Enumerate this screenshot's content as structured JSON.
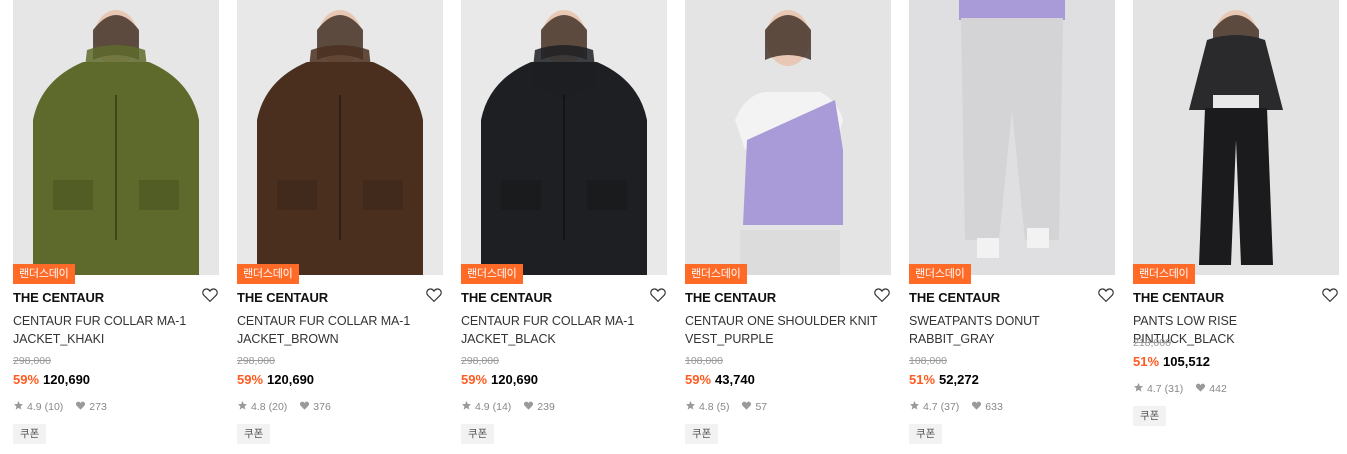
{
  "colors": {
    "accent": "#ff6a27",
    "discount": "#ff5a1f"
  },
  "products": [
    {
      "badge": "랜더스데이",
      "brand": "THE CENTAUR",
      "name": "CENTAUR FUR COLLAR MA-1 JACKET_KHAKI",
      "original_price": "298,000",
      "discount": "59%",
      "price": "120,690",
      "rating": "4.9",
      "reviews": "(10)",
      "likes": "273",
      "coupon": "쿠폰",
      "garment_color": "#5e6a2c",
      "bg_color": "#e6e6e6"
    },
    {
      "badge": "랜더스데이",
      "brand": "THE CENTAUR",
      "name": "CENTAUR FUR COLLAR MA-1 JACKET_BROWN",
      "original_price": "298,000",
      "discount": "59%",
      "price": "120,690",
      "rating": "4.8",
      "reviews": "(20)",
      "likes": "376",
      "coupon": "쿠폰",
      "garment_color": "#4a2f1f",
      "bg_color": "#e8e8e8"
    },
    {
      "badge": "랜더스데이",
      "brand": "THE CENTAUR",
      "name": "CENTAUR FUR COLLAR MA-1 JACKET_BLACK",
      "original_price": "298,000",
      "discount": "59%",
      "price": "120,690",
      "rating": "4.9",
      "reviews": "(14)",
      "likes": "239",
      "coupon": "쿠폰",
      "garment_color": "#1d1f22",
      "bg_color": "#e9e9e9"
    },
    {
      "badge": "랜더스데이",
      "brand": "THE CENTAUR",
      "name": "CENTAUR ONE SHOULDER KNIT VEST_PURPLE",
      "original_price": "108,000",
      "discount": "59%",
      "price": "43,740",
      "rating": "4.8",
      "reviews": "(5)",
      "likes": "57",
      "coupon": "쿠폰",
      "garment_color": "#a99ad8",
      "bg_color": "#e4e4e4"
    },
    {
      "badge": "랜더스데이",
      "brand": "THE CENTAUR",
      "name": "SWEATPANTS DONUT RABBIT_GRAY",
      "original_price": "108,000",
      "discount": "51%",
      "price": "52,272",
      "rating": "4.7",
      "reviews": "(37)",
      "likes": "633",
      "coupon": "쿠폰",
      "garment_color": "#d4d4d6",
      "bg_color": "#dfdfe1"
    },
    {
      "badge": "랜더스데이",
      "brand": "THE CENTAUR",
      "name": "PANTS LOW RISE PINTUCK_BLACK",
      "original_price": "218,000",
      "discount": "51%",
      "price": "105,512",
      "rating": "4.7",
      "reviews": "(31)",
      "likes": "442",
      "coupon": "쿠폰",
      "garment_color": "#1b1b1d",
      "bg_color": "#e3e3e3"
    }
  ]
}
